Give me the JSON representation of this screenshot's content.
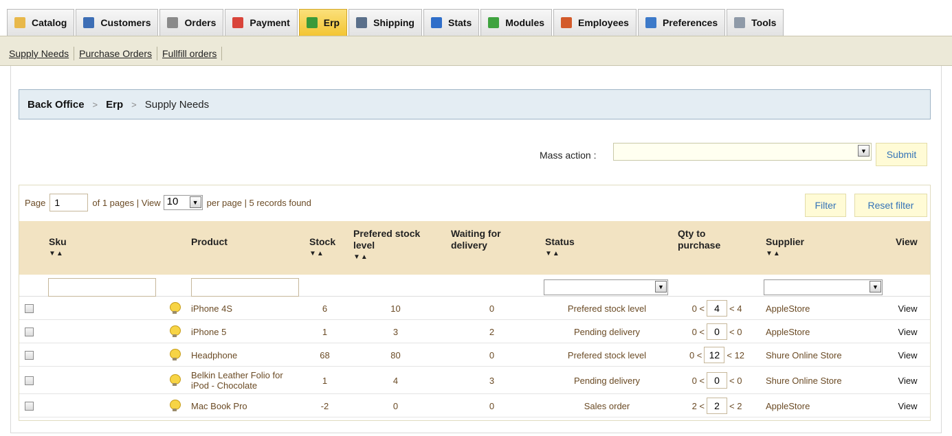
{
  "tabs": [
    {
      "label": "Catalog",
      "icon": "folder-icon",
      "color": "#e8b84a"
    },
    {
      "label": "Customers",
      "icon": "customers-icon",
      "color": "#3d6eb5"
    },
    {
      "label": "Orders",
      "icon": "cart-icon",
      "color": "#8a8a8a"
    },
    {
      "label": "Payment",
      "icon": "payment-icon",
      "color": "#d9443a"
    },
    {
      "label": "Erp",
      "icon": "erp-icon",
      "color": "#3a9a3a"
    },
    {
      "label": "Shipping",
      "icon": "truck-icon",
      "color": "#5a6f8a"
    },
    {
      "label": "Stats",
      "icon": "bar-chart-icon",
      "color": "#2f6ec9"
    },
    {
      "label": "Modules",
      "icon": "puzzle-icon",
      "color": "#3fa33f"
    },
    {
      "label": "Employees",
      "icon": "employees-icon",
      "color": "#d35a2a"
    },
    {
      "label": "Preferences",
      "icon": "preferences-icon",
      "color": "#3d7ac9"
    },
    {
      "label": "Tools",
      "icon": "wrench-icon",
      "color": "#8f9aa8"
    }
  ],
  "active_tab": "Erp",
  "submenu": [
    "Supply Needs",
    "Purchase Orders",
    "Fullfill orders"
  ],
  "breadcrumb": {
    "root": "Back Office",
    "section": "Erp",
    "current": "Supply Needs",
    "separator": ">"
  },
  "mass_action": {
    "label": "Mass action :",
    "selected": "",
    "submit_label": "Submit"
  },
  "pager": {
    "page_label": "Page",
    "page_value": "1",
    "of_text": "of 1 pages | View",
    "per_page_value": "10",
    "records_text": "per page | 5 records found",
    "filter_label": "Filter",
    "reset_label": "Reset filter"
  },
  "columns": {
    "sku": "Sku",
    "product": "Product",
    "stock": "Stock",
    "prefered_1": "Prefered stock",
    "prefered_2": "level",
    "waiting_1": "Waiting for",
    "waiting_2": "delivery",
    "status": "Status",
    "qty_1": "Qty to",
    "qty_2": "purchase",
    "supplier": "Supplier",
    "view": "View",
    "sort_arrows": "▼▲"
  },
  "rows": [
    {
      "product": "iPhone 4S",
      "product_2": "",
      "stock": "6",
      "prefered": "10",
      "waiting": "0",
      "status": "Prefered stock level",
      "qty_min": "0 <",
      "qty": "4",
      "qty_max": "< 4",
      "supplier": "AppleStore",
      "view": "View"
    },
    {
      "product": "iPhone 5",
      "product_2": "",
      "stock": "1",
      "prefered": "3",
      "waiting": "2",
      "status": "Pending delivery",
      "qty_min": "0 <",
      "qty": "0",
      "qty_max": "< 0",
      "supplier": "AppleStore",
      "view": "View"
    },
    {
      "product": "Headphone",
      "product_2": "",
      "stock": "68",
      "prefered": "80",
      "waiting": "0",
      "status": "Prefered stock level",
      "qty_min": "0 <",
      "qty": "12",
      "qty_max": "< 12",
      "supplier": "Shure Online Store",
      "view": "View"
    },
    {
      "product": "Belkin Leather Folio for",
      "product_2": "iPod - Chocolate",
      "stock": "1",
      "prefered": "4",
      "waiting": "3",
      "status": "Pending delivery",
      "qty_min": "0 <",
      "qty": "0",
      "qty_max": "< 0",
      "supplier": "Shure Online Store",
      "view": "View"
    },
    {
      "product": "Mac Book Pro",
      "product_2": "",
      "stock": "-2",
      "prefered": "0",
      "waiting": "0",
      "status": "Sales order",
      "qty_min": "2 <",
      "qty": "2",
      "qty_max": "< 2",
      "supplier": "AppleStore",
      "view": "View"
    }
  ]
}
